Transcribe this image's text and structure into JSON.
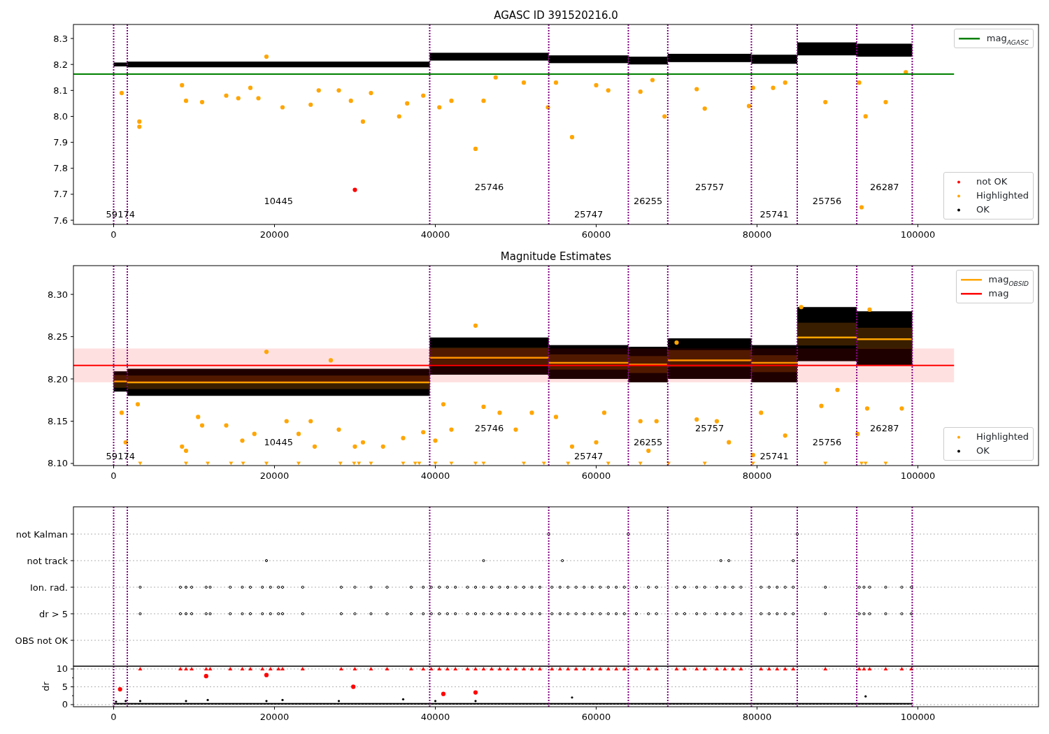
{
  "panels": [
    {
      "chart_data": {
        "type": "scatter",
        "title": "AGASC ID 391520216.0",
        "xlim": [
          -5000,
          115000
        ],
        "ylim": [
          7.584,
          8.354
        ],
        "xticks": [
          {
            "value": 0,
            "label": "0"
          },
          {
            "value": 20000,
            "label": "20000"
          },
          {
            "value": 40000,
            "label": "40000"
          },
          {
            "value": 60000,
            "label": "60000"
          },
          {
            "value": 80000,
            "label": "80000"
          },
          {
            "value": 100000,
            "label": "100000"
          }
        ],
        "yticks": [
          {
            "value": 7.6,
            "label": "7.6"
          },
          {
            "value": 7.7,
            "label": "7.7"
          },
          {
            "value": 7.8,
            "label": "7.8"
          },
          {
            "value": 7.9,
            "label": "7.9"
          },
          {
            "value": 8.0,
            "label": "8.0"
          },
          {
            "value": 8.1,
            "label": "8.1"
          },
          {
            "value": 8.2,
            "label": "8.2"
          },
          {
            "value": 8.3,
            "label": "8.3"
          }
        ],
        "series": [
          {
            "name": "Highlighted",
            "color": "#ffa500",
            "x": [
              3200,
              3200,
              1000,
              8500,
              9000,
              11000,
              14000,
              15500,
              17000,
              18000,
              19000,
              21000,
              24500,
              25500,
              28000,
              29500,
              31000,
              32000,
              35500,
              36500,
              38500,
              40500,
              42000,
              45000,
              46000,
              47500,
              51000,
              54000,
              55000,
              57000,
              60000,
              61500,
              65500,
              67000,
              68500,
              72500,
              73500,
              79000,
              79500,
              82000,
              83500,
              88500,
              92700,
              93000,
              93500,
              96000,
              98500
            ],
            "values": [
              7.98,
              7.96,
              8.09,
              8.12,
              8.06,
              8.055,
              8.08,
              8.07,
              8.11,
              8.07,
              8.23,
              8.035,
              8.045,
              8.1,
              8.1,
              8.06,
              7.98,
              8.09,
              8.0,
              8.05,
              8.08,
              8.035,
              8.06,
              7.875,
              8.06,
              8.15,
              8.13,
              8.035,
              8.13,
              7.92,
              8.12,
              8.1,
              8.095,
              8.14,
              8.0,
              8.105,
              8.03,
              8.04,
              8.11,
              8.11,
              8.13,
              8.055,
              8.13,
              7.65,
              8.0,
              8.055,
              8.17
            ]
          },
          {
            "name": "not OK",
            "color": "#ff0000",
            "x": [
              30000
            ],
            "values": [
              7.717
            ]
          }
        ],
        "ref_lines": [
          {
            "axis": "y",
            "value": 8.163,
            "label": "mag$_{AGASC}$",
            "color": "#008000"
          },
          {
            "axis": "x",
            "value": 0,
            "color": "#800080"
          },
          {
            "axis": "x",
            "value": 1700,
            "color": "#800080"
          },
          {
            "axis": "x",
            "value": 39300,
            "color": "#800080"
          },
          {
            "axis": "x",
            "value": 54100,
            "color": "#800080"
          },
          {
            "axis": "x",
            "value": 64000,
            "color": "#800080"
          },
          {
            "axis": "x",
            "value": 68900,
            "color": "#800080"
          },
          {
            "axis": "x",
            "value": 79300,
            "color": "#800080"
          },
          {
            "axis": "x",
            "value": 85000,
            "color": "#800080"
          },
          {
            "axis": "x",
            "value": 92400,
            "color": "#800080"
          },
          {
            "axis": "x",
            "value": 99300,
            "color": "#800080"
          }
        ],
        "annotations": [
          "59174",
          "10445",
          "25746",
          "25747",
          "26255",
          "25757",
          "25741",
          "25756",
          "26287"
        ]
      },
      "legend_extra": [
        {
          "kind": "dot",
          "label": "OK",
          "color": "#000000"
        }
      ]
    },
    {
      "chart_data": {
        "type": "scatter",
        "title": "Magnitude Estimates",
        "xlim": [
          -5000,
          115000
        ],
        "ylim": [
          8.0975,
          8.334
        ],
        "xticks": [
          {
            "value": 0,
            "label": "0"
          },
          {
            "value": 20000,
            "label": "20000"
          },
          {
            "value": 40000,
            "label": "40000"
          },
          {
            "value": 60000,
            "label": "60000"
          },
          {
            "value": 80000,
            "label": "80000"
          },
          {
            "value": 100000,
            "label": "100000"
          }
        ],
        "yticks": [
          {
            "value": 8.1,
            "label": "8.10"
          },
          {
            "value": 8.15,
            "label": "8.15"
          },
          {
            "value": 8.2,
            "label": "8.20"
          },
          {
            "value": 8.25,
            "label": "8.25"
          },
          {
            "value": 8.3,
            "label": "8.30"
          }
        ],
        "series": [
          {
            "name": "Highlighted",
            "color": "#ffa500",
            "x": [
              1000,
              1500,
              3000,
              8500,
              9000,
              10500,
              11000,
              14000,
              16000,
              17500,
              19000,
              21500,
              23000,
              24500,
              25000,
              27000,
              28000,
              30000,
              31000,
              33500,
              36000,
              38500,
              40000,
              41000,
              42000,
              45000,
              46000,
              48000,
              50000,
              52000,
              55000,
              57000,
              60000,
              61000,
              65500,
              66500,
              67500,
              70000,
              72500,
              75000,
              76500,
              79500,
              80500,
              83500,
              85500,
              88000,
              90000,
              92500,
              93700,
              98000,
              94000
            ],
            "values": [
              8.16,
              8.125,
              8.17,
              8.12,
              8.115,
              8.155,
              8.145,
              8.145,
              8.127,
              8.135,
              8.232,
              8.15,
              8.135,
              8.15,
              8.12,
              8.222,
              8.14,
              8.12,
              8.125,
              8.12,
              8.13,
              8.137,
              8.127,
              8.17,
              8.14,
              8.263,
              8.167,
              8.16,
              8.14,
              8.16,
              8.155,
              8.12,
              8.125,
              8.16,
              8.15,
              8.115,
              8.15,
              8.243,
              8.152,
              8.15,
              8.125,
              8.11,
              8.16,
              8.133,
              8.285,
              8.168,
              8.187,
              8.135,
              8.165,
              8.165,
              8.282
            ]
          },
          {
            "color": "#ffa500",
            "x": [
              3300,
              9000,
              11700,
              14600,
              16100,
              19000,
              23000,
              28200,
              29900,
              30500,
              32000,
              36000,
              37500,
              38000,
              40000,
              42000,
              45000,
              46000,
              51000,
              53500,
              56500,
              61500,
              65500,
              69000,
              73500,
              79500,
              88500,
              93000,
              93500,
              96000
            ],
            "values": [
              8.1,
              8.1,
              8.1,
              8.1,
              8.1,
              8.1,
              8.1,
              8.1,
              8.1,
              8.1,
              8.1,
              8.1,
              8.1,
              8.1,
              8.1,
              8.1,
              8.1,
              8.1,
              8.1,
              8.1,
              8.1,
              8.1,
              8.1,
              8.1,
              8.1,
              8.1,
              8.1,
              8.1,
              8.1,
              8.1
            ]
          }
        ],
        "ref_lines": [
          {
            "axis": "y",
            "value": 8.216,
            "label": "mag",
            "color": "#ff0000"
          },
          {
            "axis": "x",
            "value": 0,
            "color": "#800080"
          },
          {
            "axis": "x",
            "value": 1700,
            "color": "#800080"
          },
          {
            "axis": "x",
            "value": 39300,
            "color": "#800080"
          },
          {
            "axis": "x",
            "value": 54100,
            "color": "#800080"
          },
          {
            "axis": "x",
            "value": 64000,
            "color": "#800080"
          },
          {
            "axis": "x",
            "value": 68900,
            "color": "#800080"
          },
          {
            "axis": "x",
            "value": 79300,
            "color": "#800080"
          },
          {
            "axis": "x",
            "value": 85000,
            "color": "#800080"
          },
          {
            "axis": "x",
            "value": 92400,
            "color": "#800080"
          },
          {
            "axis": "x",
            "value": 99300,
            "color": "#800080"
          }
        ],
        "bands": [
          {
            "axis": "y",
            "from": 8.196,
            "to": 8.236,
            "color": "#ff0000"
          }
        ],
        "annotations": [
          "59174",
          "10445",
          "25746",
          "25747",
          "26255",
          "25757",
          "25741",
          "25756",
          "26287"
        ]
      },
      "legend_extra": [
        {
          "kind": "line",
          "label": "mag$_{OBSID}$",
          "color": "#ffa500"
        },
        {
          "kind": "dot",
          "label": "OK",
          "color": "#000000"
        }
      ]
    }
  ],
  "flags": {
    "rows": [
      {
        "label": "not Kalman"
      },
      {
        "label": "not track"
      },
      {
        "label": "Ion. rad."
      },
      {
        "label": "dr > 5"
      },
      {
        "label": "OBS not OK"
      }
    ]
  },
  "dr_chart": {
    "chart_data": {
      "type": "scatter",
      "ylabel": "dr",
      "grid": true,
      "xlim": [
        -5000,
        115000
      ],
      "ylim": [
        -0.6,
        10.78
      ],
      "xticks": [
        {
          "value": 0,
          "label": "0"
        },
        {
          "value": 20000,
          "label": "20000"
        },
        {
          "value": 40000,
          "label": "40000"
        },
        {
          "value": 60000,
          "label": "60000"
        },
        {
          "value": 80000,
          "label": "80000"
        },
        {
          "value": 100000,
          "label": "100000"
        }
      ],
      "yticks": [
        {
          "value": 0,
          "label": "0"
        },
        {
          "value": 5,
          "label": "5"
        },
        {
          "value": 10,
          "label": "10"
        }
      ],
      "series": [
        {
          "color": "#ff0000",
          "x": [
            3300,
            8300,
            9000,
            9700,
            11500,
            12000,
            14500,
            16000,
            17000,
            18500,
            19500,
            20500,
            21000,
            23500,
            28300,
            30000,
            32000,
            34000,
            37000,
            38500,
            39500,
            40500,
            41500,
            42500,
            44000,
            45000,
            46000,
            47000,
            48000,
            49000,
            50000,
            51000,
            52000,
            53000,
            54500,
            55500,
            56500,
            57500,
            58500,
            59500,
            60500,
            61500,
            62500,
            63500,
            65000,
            66500,
            67500,
            70000,
            71000,
            72500,
            73500,
            75000,
            76000,
            77000,
            78000,
            80500,
            81500,
            82500,
            83500,
            84500,
            88500,
            92700,
            93300,
            94000,
            96000,
            98000,
            99200
          ],
          "values": [
            10,
            10,
            10,
            10,
            10,
            10,
            10,
            10,
            10,
            10,
            10,
            10,
            10,
            10,
            10,
            10,
            10,
            10,
            10,
            10,
            10,
            10,
            10,
            10,
            10,
            10,
            10,
            10,
            10,
            10,
            10,
            10,
            10,
            10,
            10,
            10,
            10,
            10,
            10,
            10,
            10,
            10,
            10,
            10,
            10,
            10,
            10,
            10,
            10,
            10,
            10,
            10,
            10,
            10,
            10,
            10,
            10,
            10,
            10,
            10,
            10,
            10,
            10,
            10,
            10,
            10,
            10
          ]
        },
        {
          "color": "#ff0000",
          "x": [
            800,
            11500,
            19000,
            29800,
            41000,
            45000
          ],
          "values": [
            4.3,
            8,
            8.3,
            5,
            3,
            3.4
          ]
        }
      ],
      "ref_lines": [
        {
          "axis": "x",
          "value": 0,
          "color": "#800080"
        },
        {
          "axis": "x",
          "value": 1700,
          "color": "#800080"
        },
        {
          "axis": "x",
          "value": 39300,
          "color": "#800080"
        },
        {
          "axis": "x",
          "value": 54100,
          "color": "#800080"
        },
        {
          "axis": "x",
          "value": 64000,
          "color": "#800080"
        },
        {
          "axis": "x",
          "value": 68900,
          "color": "#800080"
        },
        {
          "axis": "x",
          "value": 79300,
          "color": "#800080"
        },
        {
          "axis": "x",
          "value": 85000,
          "color": "#800080"
        },
        {
          "axis": "x",
          "value": 92400,
          "color": "#800080"
        },
        {
          "axis": "x",
          "value": 99300,
          "color": "#800080"
        }
      ]
    }
  }
}
